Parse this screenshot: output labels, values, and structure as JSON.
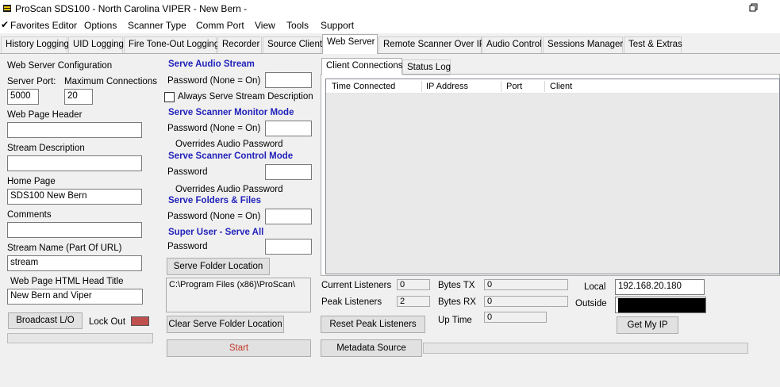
{
  "window": {
    "title": "ProScan SDS100 - North Carolina VIPER - New Bern -"
  },
  "menu": [
    "Favorites Editor",
    "Options",
    "Scanner Type",
    "Comm Port",
    "View",
    "Tools",
    "Support"
  ],
  "tabs": [
    "History Logging",
    "UID Logging",
    "Fire Tone-Out Logging",
    "Recorder",
    "Source Client",
    "Web Server",
    "Remote Scanner Over IP",
    "Audio Control",
    "Sessions Manager",
    "Test & Extras"
  ],
  "config": {
    "heading": "Web Server Configuration",
    "server_port_label": "Server Port:",
    "server_port": "5000",
    "max_conn_label": "Maximum Connections",
    "max_conn": "20",
    "web_header_label": "Web Page Header",
    "web_header": "",
    "stream_desc_label": "Stream Description",
    "stream_desc": "",
    "home_page_label": "Home Page",
    "home_page": "SDS100 New Bern",
    "comments_label": "Comments",
    "comments": "",
    "stream_name_label": "Stream Name (Part Of URL)",
    "stream_name": "stream",
    "html_title_label": "Web Page HTML Head Title",
    "html_title": "New Bern and Viper",
    "broadcast_btn": "Broadcast L/O",
    "lockout_label": "Lock Out",
    "lockout_color": "#c0504d"
  },
  "serve": {
    "audio_heading": "Serve Audio Stream",
    "pw_none_label": "Password (None = On)",
    "always_serve_label": "Always Serve Stream Description",
    "monitor_heading": "Serve Scanner Monitor Mode",
    "overrides_label": "Overrides Audio Password",
    "control_heading": "Serve Scanner Control Mode",
    "pw_label": "Password",
    "folders_heading": "Serve Folders & Files",
    "super_heading": "Super User - Serve All",
    "folder_loc_btn": "Serve Folder Location",
    "folder_path": "C:\\Program Files (x86)\\ProScan\\",
    "clear_folder_btn": "Clear Serve Folder Location",
    "start_btn": "Start",
    "start_color": "#c0392b"
  },
  "connections": {
    "tabs": [
      "Client Connections",
      "Status Log"
    ],
    "columns": [
      "Time Connected",
      "IP Address",
      "Port",
      "Client"
    ]
  },
  "stats": {
    "current_listeners_label": "Current Listeners",
    "current_listeners": "0",
    "peak_listeners_label": "Peak Listeners",
    "peak_listeners": "2",
    "bytes_tx_label": "Bytes TX",
    "bytes_tx": "0",
    "bytes_rx_label": "Bytes RX",
    "bytes_rx": "0",
    "uptime_label": "Up Time",
    "uptime": "0",
    "reset_btn": "Reset Peak Listeners",
    "metadata_btn": "Metadata Source",
    "local_label": "Local",
    "local_ip": "192.168.20.180",
    "outside_label": "Outside",
    "get_ip_btn": "Get My IP"
  }
}
